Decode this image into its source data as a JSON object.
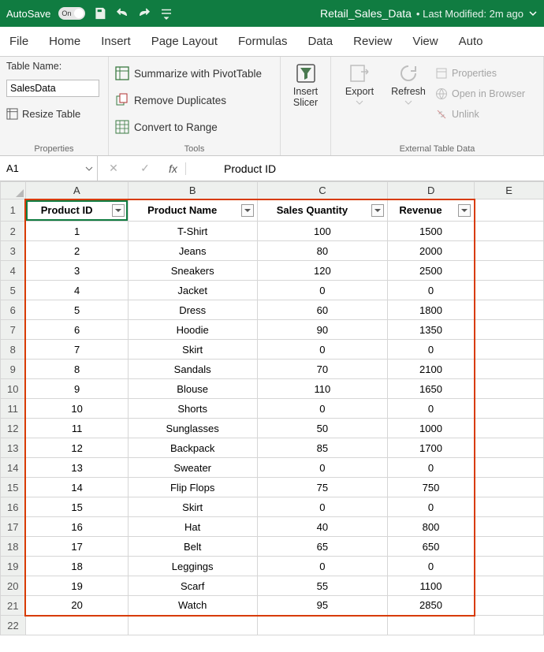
{
  "titlebar": {
    "autosave_label": "AutoSave",
    "autosave_on": "On",
    "filename": "Retail_Sales_Data",
    "modified": "• Last Modified: 2m ago"
  },
  "tabs": [
    "File",
    "Home",
    "Insert",
    "Page Layout",
    "Formulas",
    "Data",
    "Review",
    "View",
    "Auto"
  ],
  "ribbon": {
    "properties": {
      "label": "Table Name:",
      "value": "SalesData",
      "resize": "Resize Table",
      "caption": "Properties"
    },
    "tools": {
      "pivot": "Summarize with PivotTable",
      "dupes": "Remove Duplicates",
      "range": "Convert to Range",
      "caption": "Tools"
    },
    "slicer": {
      "l1": "Insert",
      "l2": "Slicer"
    },
    "export": "Export",
    "refresh": "Refresh",
    "ext": {
      "prop": "Properties",
      "open": "Open in Browser",
      "unlink": "Unlink",
      "caption": "External Table Data"
    }
  },
  "formulabar": {
    "cell": "A1",
    "fx": "fx",
    "value": "Product ID"
  },
  "columns": [
    "A",
    "B",
    "C",
    "D",
    "E"
  ],
  "headers": [
    "Product ID",
    "Product Name",
    "Sales Quantity",
    "Revenue"
  ],
  "rows": [
    {
      "n": 2,
      "id": "1",
      "name": "T-Shirt",
      "qty": "100",
      "rev": "1500"
    },
    {
      "n": 3,
      "id": "2",
      "name": "Jeans",
      "qty": "80",
      "rev": "2000"
    },
    {
      "n": 4,
      "id": "3",
      "name": "Sneakers",
      "qty": "120",
      "rev": "2500"
    },
    {
      "n": 5,
      "id": "4",
      "name": "Jacket",
      "qty": "0",
      "rev": "0"
    },
    {
      "n": 6,
      "id": "5",
      "name": "Dress",
      "qty": "60",
      "rev": "1800"
    },
    {
      "n": 7,
      "id": "6",
      "name": "Hoodie",
      "qty": "90",
      "rev": "1350"
    },
    {
      "n": 8,
      "id": "7",
      "name": "Skirt",
      "qty": "0",
      "rev": "0"
    },
    {
      "n": 9,
      "id": "8",
      "name": "Sandals",
      "qty": "70",
      "rev": "2100"
    },
    {
      "n": 10,
      "id": "9",
      "name": "Blouse",
      "qty": "110",
      "rev": "1650"
    },
    {
      "n": 11,
      "id": "10",
      "name": "Shorts",
      "qty": "0",
      "rev": "0"
    },
    {
      "n": 12,
      "id": "11",
      "name": "Sunglasses",
      "qty": "50",
      "rev": "1000"
    },
    {
      "n": 13,
      "id": "12",
      "name": "Backpack",
      "qty": "85",
      "rev": "1700"
    },
    {
      "n": 14,
      "id": "13",
      "name": "Sweater",
      "qty": "0",
      "rev": "0"
    },
    {
      "n": 15,
      "id": "14",
      "name": "Flip Flops",
      "qty": "75",
      "rev": "750"
    },
    {
      "n": 16,
      "id": "15",
      "name": "Skirt",
      "qty": "0",
      "rev": "0"
    },
    {
      "n": 17,
      "id": "16",
      "name": "Hat",
      "qty": "40",
      "rev": "800"
    },
    {
      "n": 18,
      "id": "17",
      "name": "Belt",
      "qty": "65",
      "rev": "650"
    },
    {
      "n": 19,
      "id": "18",
      "name": "Leggings",
      "qty": "0",
      "rev": "0"
    },
    {
      "n": 20,
      "id": "19",
      "name": "Scarf",
      "qty": "55",
      "rev": "1100"
    },
    {
      "n": 21,
      "id": "20",
      "name": "Watch",
      "qty": "95",
      "rev": "2850"
    }
  ],
  "chart_data": {
    "type": "table",
    "columns": [
      "Product ID",
      "Product Name",
      "Sales Quantity",
      "Revenue"
    ],
    "data": [
      [
        1,
        "T-Shirt",
        100,
        1500
      ],
      [
        2,
        "Jeans",
        80,
        2000
      ],
      [
        3,
        "Sneakers",
        120,
        2500
      ],
      [
        4,
        "Jacket",
        0,
        0
      ],
      [
        5,
        "Dress",
        60,
        1800
      ],
      [
        6,
        "Hoodie",
        90,
        1350
      ],
      [
        7,
        "Skirt",
        0,
        0
      ],
      [
        8,
        "Sandals",
        70,
        2100
      ],
      [
        9,
        "Blouse",
        110,
        1650
      ],
      [
        10,
        "Shorts",
        0,
        0
      ],
      [
        11,
        "Sunglasses",
        50,
        1000
      ],
      [
        12,
        "Backpack",
        85,
        1700
      ],
      [
        13,
        "Sweater",
        0,
        0
      ],
      [
        14,
        "Flip Flops",
        75,
        750
      ],
      [
        15,
        "Skirt",
        0,
        0
      ],
      [
        16,
        "Hat",
        40,
        800
      ],
      [
        17,
        "Belt",
        65,
        650
      ],
      [
        18,
        "Leggings",
        0,
        0
      ],
      [
        19,
        "Scarf",
        55,
        1100
      ],
      [
        20,
        "Watch",
        95,
        2850
      ]
    ]
  }
}
